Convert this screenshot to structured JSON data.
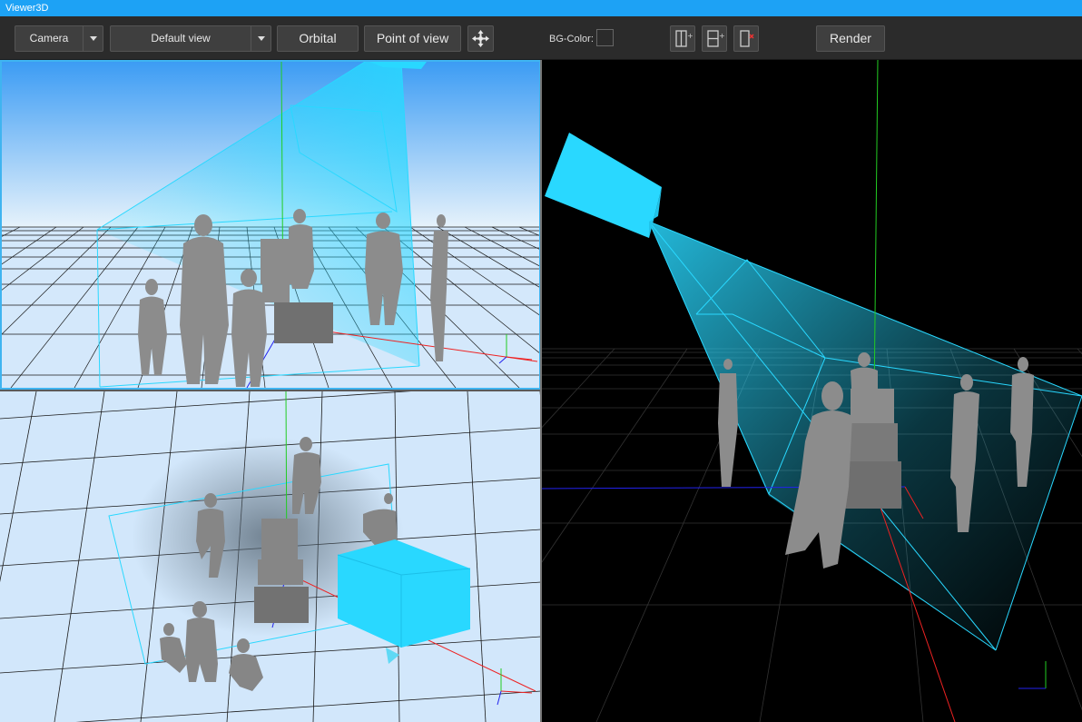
{
  "window": {
    "title": "Viewer3D"
  },
  "toolbar": {
    "camera_select": "Camera",
    "view_select": "Default view",
    "orbital_label": "Orbital",
    "point_of_view_label": "Point of view",
    "move_icon": "move-arrows-icon",
    "bg_color_label": "BG-Color:",
    "bg_color_value": "#2b2b2b",
    "split_vertical_icon": "split-vertical-icon",
    "split_horizontal_icon": "split-horizontal-icon",
    "remove_view_icon": "remove-view-icon",
    "render_label": "Render"
  },
  "colors": {
    "accent": "#1da2f5",
    "camera": "#29d8ff",
    "sky_top": "#3d9ff5",
    "floor": "#cfe6fb",
    "silhouette": "#8a8a8a"
  }
}
